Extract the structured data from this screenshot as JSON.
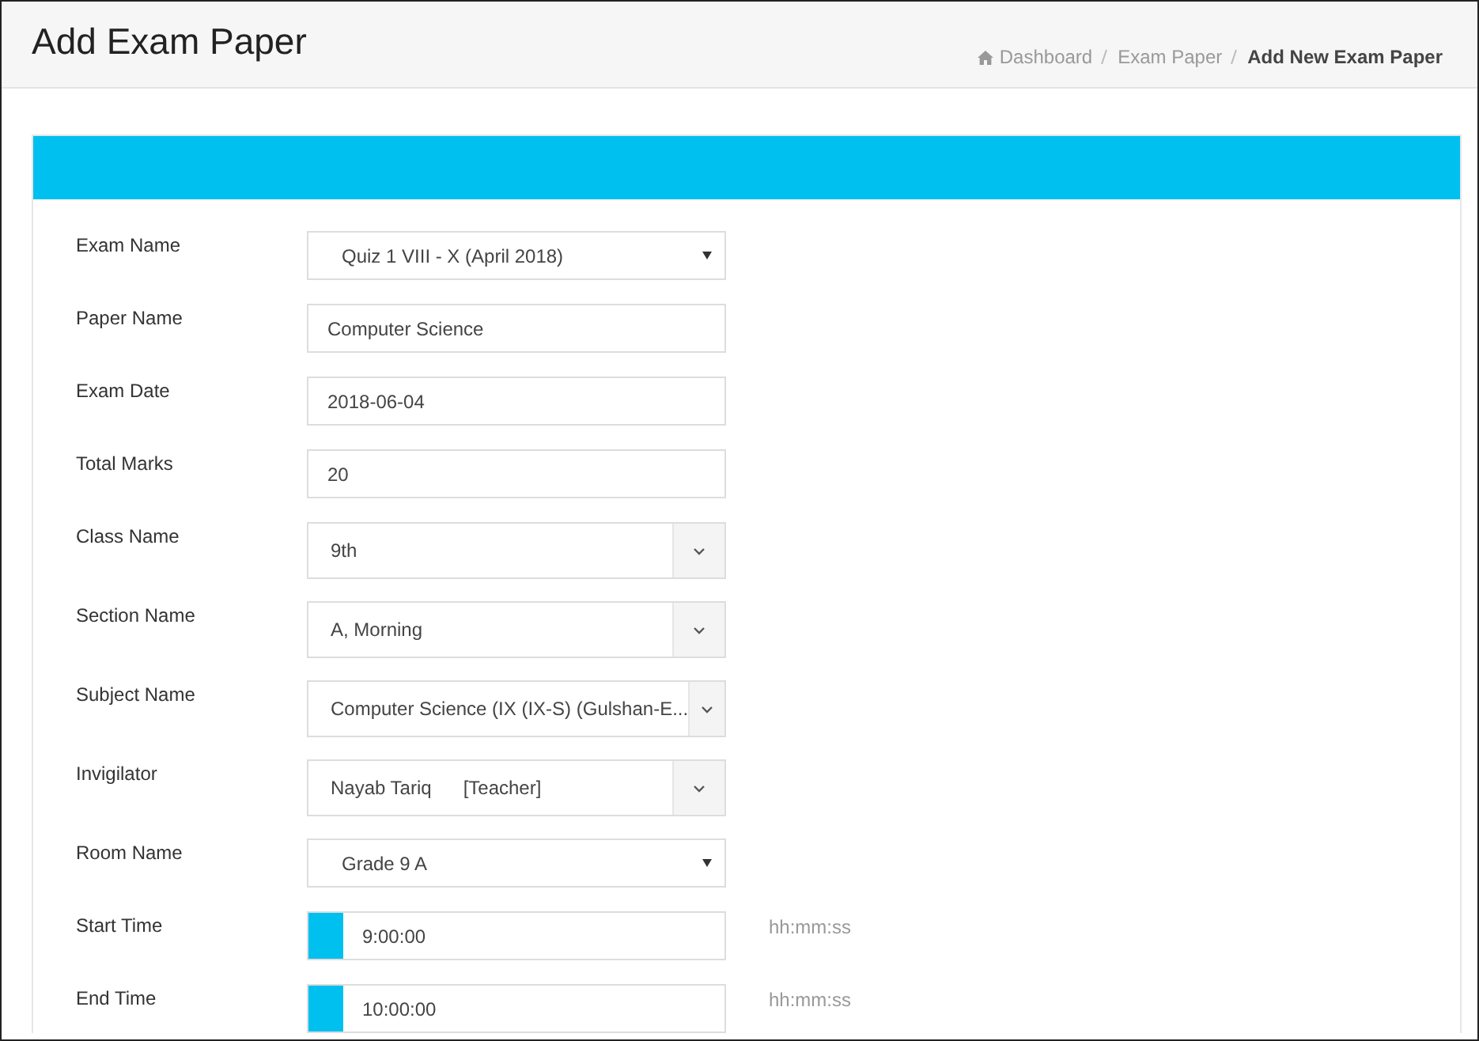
{
  "page_title": "Add Exam Paper",
  "breadcrumb": [
    {
      "label": "Dashboard",
      "kind": "home"
    },
    {
      "label": "Exam Paper",
      "kind": "link"
    },
    {
      "label": "Add New Exam Paper",
      "kind": "current"
    }
  ],
  "fields": [
    {
      "label": "Exam Name",
      "kind": "select",
      "value": "Quiz 1 VIII - X (April 2018)"
    },
    {
      "label": "Paper Name",
      "kind": "input",
      "value": "Computer Science"
    },
    {
      "label": "Exam Date",
      "kind": "input",
      "value": "2018-06-04"
    },
    {
      "label": "Total Marks",
      "kind": "input",
      "value": "20"
    },
    {
      "label": "Class Name",
      "kind": "combo",
      "value": "9th"
    },
    {
      "label": "Section Name",
      "kind": "combo",
      "value": "A, Morning"
    },
    {
      "label": "Subject Name",
      "kind": "combo",
      "value": "Computer Science (IX (IX-S) (Gulshan-E..."
    },
    {
      "label": "Invigilator",
      "kind": "combo",
      "value": "Nayab Tariq",
      "extra": "[Teacher]"
    },
    {
      "label": "Room Name",
      "kind": "select",
      "value": "Grade 9 A"
    },
    {
      "label": "Start Time",
      "kind": "time",
      "value": "9:00:00",
      "hint": "hh:mm:ss"
    },
    {
      "label": "End Time",
      "kind": "time",
      "value": "10:00:00",
      "hint": "hh:mm:ss"
    }
  ]
}
